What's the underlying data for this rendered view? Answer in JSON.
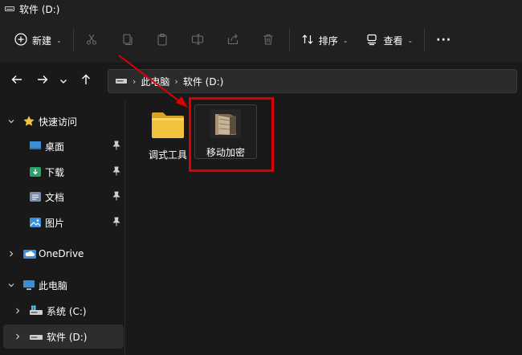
{
  "window": {
    "title": "软件 (D:)"
  },
  "toolbar": {
    "new_label": "新建",
    "sort_label": "排序",
    "view_label": "查看",
    "more_label": "···"
  },
  "address": {
    "crumbs": [
      "此电脑",
      "软件 (D:)"
    ]
  },
  "nav": {
    "quick_access": "快速访问",
    "desktop": "桌面",
    "downloads": "下载",
    "documents": "文档",
    "pictures": "图片",
    "onedrive": "OneDrive",
    "this_pc": "此电脑",
    "system_c": "系统 (C:)",
    "software_d": "软件 (D:)"
  },
  "content": {
    "items": [
      {
        "label": "调式工具",
        "type": "folder"
      },
      {
        "label": "移动加密",
        "type": "encrypted-folder"
      }
    ]
  },
  "colors": {
    "highlight": "#e00000",
    "folder": "#f3c23f",
    "accent": "#60cdff"
  }
}
